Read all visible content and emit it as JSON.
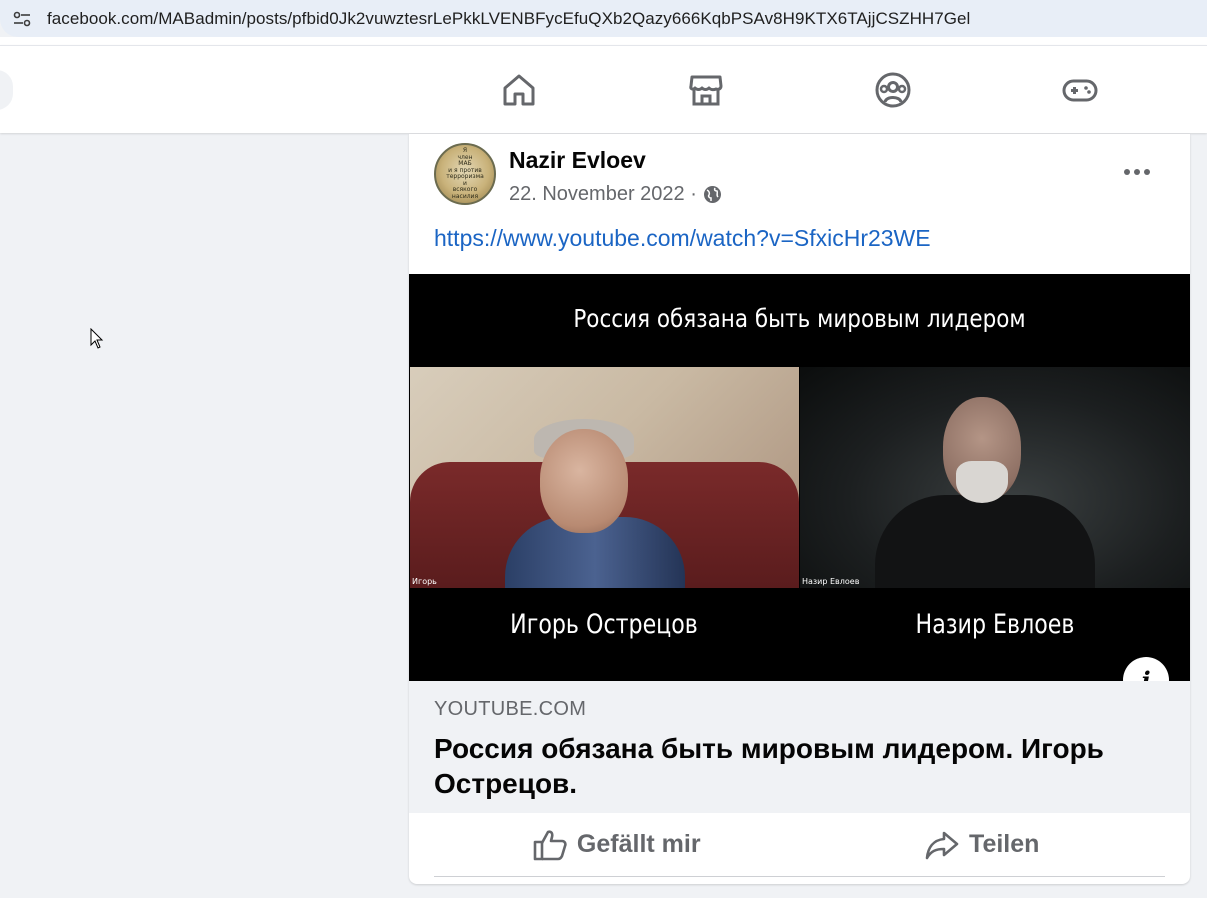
{
  "browser": {
    "url": "facebook.com/MABadmin/posts/pfbid0Jk2vuwztesrLePkkLVENBFycEfuQXb2Qazy666KqbPSAv8H9KTX6TAjjCSZHH7Gel"
  },
  "nav": {
    "icons": [
      "home-icon",
      "marketplace-icon",
      "groups-icon",
      "gaming-icon"
    ]
  },
  "post": {
    "author": "Nazir Evloev",
    "date": "22. November 2022 ·",
    "avatar_text": [
      "Я",
      "член",
      "МАБ",
      "и я против",
      "терроризма",
      "и",
      "всякого",
      "насилия"
    ],
    "link_text": "https://www.youtube.com/watch?v=SfxicHr23WE",
    "video": {
      "title_overlay": "Россия обязана быть мировым лидером",
      "left_caption": "Игорь",
      "right_caption": "Назир Евлоев",
      "left_name": "Игорь Острецов",
      "right_name": "Назир Евлоев"
    },
    "preview": {
      "domain": "YOUTUBE.COM",
      "title": "Россия обязана быть мировым лидером. Игорь Острецов."
    },
    "actions": {
      "like": "Gefällt mir",
      "share": "Teilen"
    }
  },
  "colors": {
    "link": "#1b65c4",
    "secondary_text": "#65676b",
    "page_bg": "#f0f2f5"
  }
}
